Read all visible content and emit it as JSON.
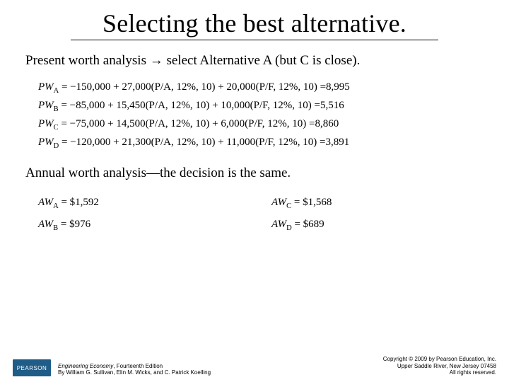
{
  "title": "Selecting the best alternative.",
  "intro1": "Present worth analysis → select Alternative A (but C is close).",
  "pw": {
    "A": {
      "label": "PW",
      "sub": "A",
      "expr": " = −150,000 + 27,000(P/A, 12%, 10) + 20,000(P/F, 12%, 10) =",
      "result": "8,995"
    },
    "B": {
      "label": "PW",
      "sub": "B",
      "expr": " = −85,000 + 15,450(P/A, 12%, 10) + 10,000(P/F, 12%, 10) =",
      "result": "5,516"
    },
    "C": {
      "label": "PW",
      "sub": "C",
      "expr": " = −75,000 + 14,500(P/A, 12%, 10) + 6,000(P/F, 12%, 10) =",
      "result": "8,860"
    },
    "D": {
      "label": "PW",
      "sub": "D",
      "expr": " = −120,000 + 21,300(P/A, 12%, 10) + 11,000(P/F, 12%, 10) =",
      "result": "3,891"
    }
  },
  "intro2": "Annual worth analysis—the decision is the same.",
  "aw": {
    "A": {
      "label": "AW",
      "sub": "A",
      "eq": " = $1,592"
    },
    "B": {
      "label": "AW",
      "sub": "B",
      "eq": " = $976"
    },
    "C": {
      "label": "AW",
      "sub": "C",
      "eq": " = $1,568"
    },
    "D": {
      "label": "AW",
      "sub": "D",
      "eq": " = $689"
    }
  },
  "footer": {
    "logo": "PEARSON",
    "book_title": "Engineering Economy",
    "edition": ", Fourteenth Edition",
    "authors": "By William G. Sullivan, Elin M. Wicks, and C. Patrick Koelling",
    "copyright": "Copyright © 2009 by Pearson Education, Inc.\nUpper Saddle River, New Jersey 07458\nAll rights reserved."
  }
}
